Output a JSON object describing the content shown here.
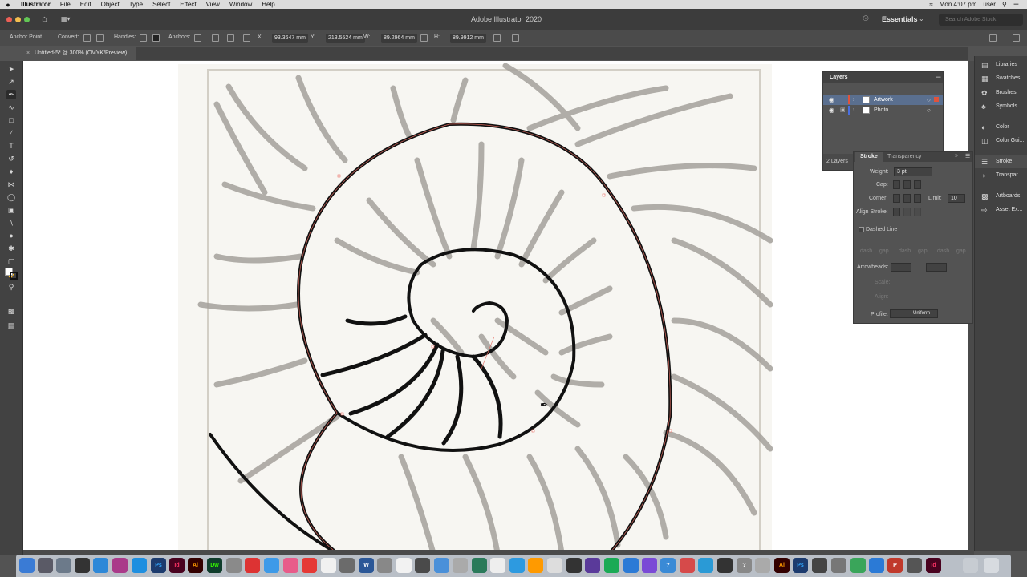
{
  "menubar": {
    "items": [
      "Illustrator",
      "File",
      "Edit",
      "Object",
      "Type",
      "Select",
      "Effect",
      "View",
      "Window",
      "Help"
    ],
    "clock": "Mon 4:07 pm",
    "user": "user"
  },
  "titlebar": {
    "title": "Adobe Illustrator 2020",
    "workspace": "Essentials",
    "search_placeholder": "Search Adobe Stock"
  },
  "control": {
    "tool_name": "Anchor Point",
    "convert_label": "Convert:",
    "handles_label": "Handles:",
    "anchors_label": "Anchors:",
    "x_label": "X:",
    "x_value": "93.3647 mm",
    "y_label": "Y:",
    "y_value": "213.5524 mm",
    "w_label": "W:",
    "w_value": "89.2964 mm",
    "h_label": "H:",
    "h_value": "89.9912 mm"
  },
  "document": {
    "tab_title": "Untitled-5* @ 300% (CMYK/Preview)"
  },
  "dock": {
    "items": [
      "Libraries",
      "Swatches",
      "Brushes",
      "Symbols",
      "Color",
      "Color Gui...",
      "Stroke",
      "Transpar...",
      "Artboards",
      "Asset Ex..."
    ],
    "active": "Stroke"
  },
  "layers": {
    "title": "Layers",
    "rows": [
      {
        "name": "Artwork",
        "color": "#e0533c",
        "selected": true
      },
      {
        "name": "Photo",
        "color": "#4a6fe0",
        "selected": false
      }
    ],
    "footer": "2 Layers"
  },
  "stroke": {
    "tabs": [
      "Stroke",
      "Transparency"
    ],
    "weight_label": "Weight:",
    "weight_value": "3 pt",
    "cap_label": "Cap:",
    "corner_label": "Corner:",
    "limit_label": "Limit:",
    "limit_value": "10",
    "align_label": "Align Stroke:",
    "dashed_label": "Dashed Line",
    "dash_labels": [
      "dash",
      "gap",
      "dash",
      "gap",
      "dash",
      "gap"
    ],
    "arrowheads_label": "Arrowheads:",
    "scale_label": "Scale:",
    "align2_label": "Align:",
    "profile_label": "Profile:",
    "profile_value": "Uniform"
  },
  "colors": {
    "app_bg": "#535353",
    "panel_dark": "#424242",
    "selection": "#5a6f8f",
    "artwork_layer": "#e0533c",
    "photo_layer": "#4a6fe0"
  }
}
